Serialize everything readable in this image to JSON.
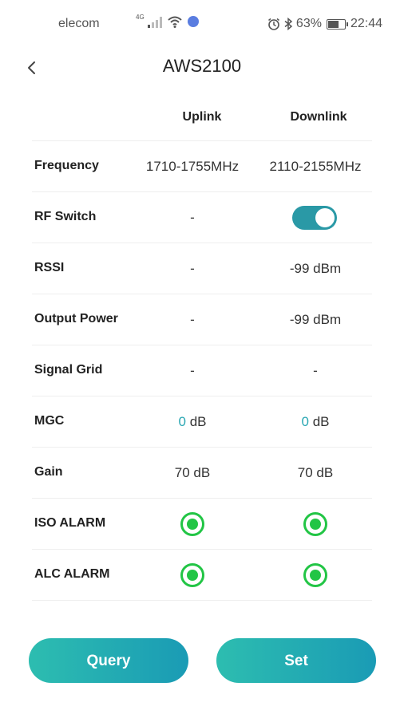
{
  "status_bar": {
    "carrier": "elecom",
    "network_label": "4G",
    "battery": "63%",
    "time": "22:44"
  },
  "header": {
    "title": "AWS2100",
    "back_icon": "chevron-left-icon"
  },
  "table": {
    "columns": {
      "uplink": "Uplink",
      "downlink": "Downlink"
    },
    "frequency": {
      "label": "Frequency",
      "uplink": "1710-1755MHz",
      "downlink": "2110-2155MHz"
    },
    "rf_switch": {
      "label": "RF Switch",
      "uplink": "-",
      "downlink_on": true
    },
    "rssi": {
      "label": "RSSI",
      "uplink": "-",
      "downlink": "-99 dBm"
    },
    "output_power": {
      "label": "Output Power",
      "uplink": "-",
      "downlink": "-99 dBm"
    },
    "signal_grid": {
      "label": "Signal Grid",
      "uplink": "-",
      "downlink": "-"
    },
    "mgc": {
      "label": "MGC",
      "uplink_value": "0",
      "downlink_value": "0",
      "unit": "dB"
    },
    "gain": {
      "label": "Gain",
      "uplink": "70 dB",
      "downlink": "70 dB"
    },
    "iso_alarm": {
      "label": "ISO ALARM",
      "uplink_status": "ok",
      "downlink_status": "ok"
    },
    "alc_alarm": {
      "label": "ALC ALARM",
      "uplink_status": "ok",
      "downlink_status": "ok"
    }
  },
  "buttons": {
    "query": "Query",
    "set": "Set"
  },
  "colors": {
    "accent": "#2a99a6",
    "alarm_ok": "#22c545",
    "button_gradient_start": "#2dbdb0",
    "button_gradient_end": "#1a9bb5"
  }
}
